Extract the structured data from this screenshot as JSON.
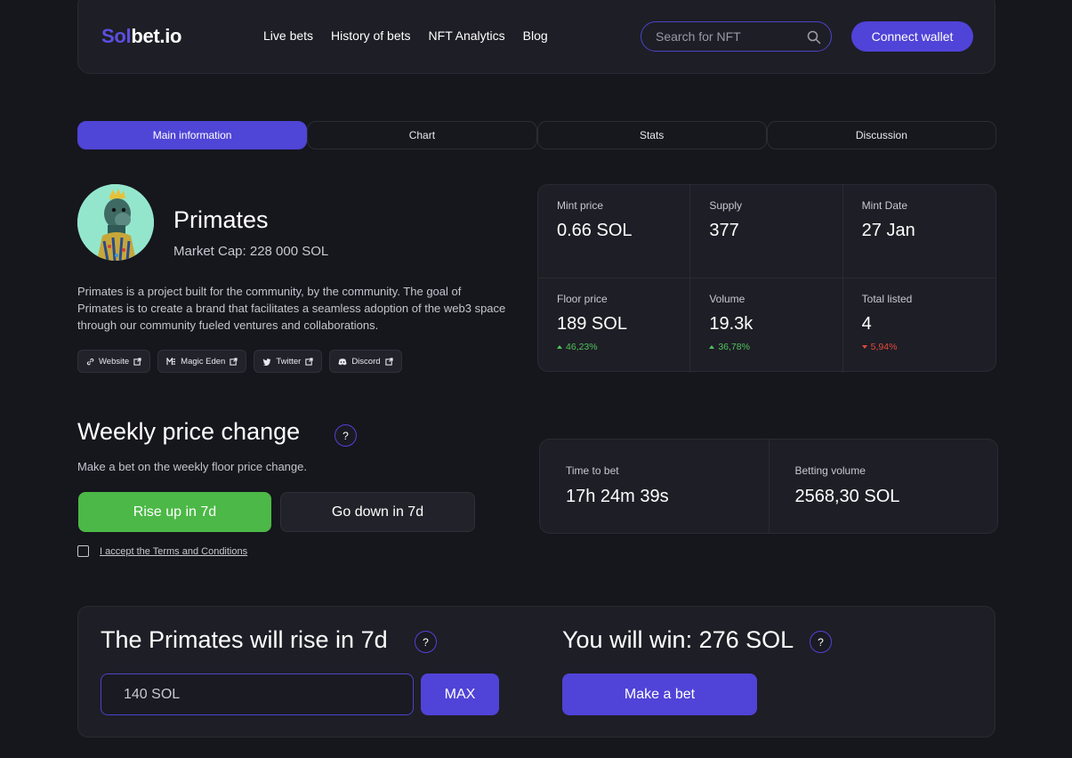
{
  "header": {
    "logo_accent": "Sol",
    "logo_rest": "bet.io",
    "nav": [
      "Live bets",
      "History of bets",
      "NFT Analytics",
      "Blog"
    ],
    "search_placeholder": "Search for NFT",
    "connect_label": "Connect wallet"
  },
  "tabs": [
    {
      "label": "Main information",
      "active": true
    },
    {
      "label": "Chart",
      "active": false
    },
    {
      "label": "Stats",
      "active": false
    },
    {
      "label": "Discussion",
      "active": false
    }
  ],
  "collection": {
    "name": "Primates",
    "market_cap": "Market Cap: 228 000 SOL",
    "description": "Primates is a project built for the community, by the community. The goal of Primates is to create a brand that facilitates a seamless adoption of the web3 space through our community fueled ventures and collaborations.",
    "links": [
      {
        "label": "Website",
        "icon": "link-icon"
      },
      {
        "label": "Magic Eden",
        "icon": "magic-eden-icon"
      },
      {
        "label": "Twitter",
        "icon": "twitter-icon"
      },
      {
        "label": "Discord",
        "icon": "discord-icon"
      }
    ]
  },
  "stats": [
    {
      "label": "Mint price",
      "value": "0.66 SOL"
    },
    {
      "label": "Supply",
      "value": "377"
    },
    {
      "label": "Mint Date",
      "value": "27 Jan"
    },
    {
      "label": "Floor price",
      "value": "189 SOL",
      "change": "46,23%",
      "direction": "up"
    },
    {
      "label": "Volume",
      "value": "19.3k",
      "change": "36,78%",
      "direction": "up"
    },
    {
      "label": "Total listed",
      "value": "4",
      "change": "5,94%",
      "direction": "down"
    }
  ],
  "weekly": {
    "title": "Weekly price change",
    "help": "?",
    "subtitle": "Make a bet on the weekly floor price change.",
    "rise_label": "Rise up in 7d",
    "down_label": "Go down in 7d",
    "terms_label": "I accept the Terms and Conditions"
  },
  "timing": {
    "time_label": "Time to bet",
    "time_value": "17h 24m 39s",
    "volume_label": "Betting volume",
    "volume_value": "2568,30 SOL"
  },
  "bet": {
    "title": "The Primates will rise in 7d",
    "win_title": "You will win: 276 SOL",
    "help": "?",
    "amount_value": "140 SOL",
    "max_label": "MAX",
    "make_bet_label": "Make a bet"
  },
  "colors": {
    "accent": "#5043d8",
    "rise": "#4cb847",
    "positive": "#4fc35a",
    "negative": "#e4473d",
    "background": "#16161d"
  }
}
